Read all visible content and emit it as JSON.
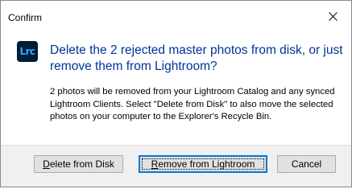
{
  "window": {
    "title": "Confirm"
  },
  "app_icon": {
    "label": "Lrc"
  },
  "dialog": {
    "heading": "Delete the 2 rejected master photos from disk, or just remove them from Lightroom?",
    "body": "2 photos will be removed from your Lightroom Catalog and any synced Lightroom Clients. Select \"Delete from Disk\" to also move the selected photos on your computer to the Explorer's Recycle Bin."
  },
  "buttons": {
    "delete_mnemonic": "D",
    "delete_rest": "elete from Disk",
    "remove_mnemonic": "R",
    "remove_rest": "emove from Lightroom",
    "cancel_label": "Cancel"
  },
  "colors": {
    "heading": "#003399",
    "focus_border": "#0078d7",
    "app_icon_bg": "#001e36",
    "app_icon_text": "#31a8ff"
  }
}
